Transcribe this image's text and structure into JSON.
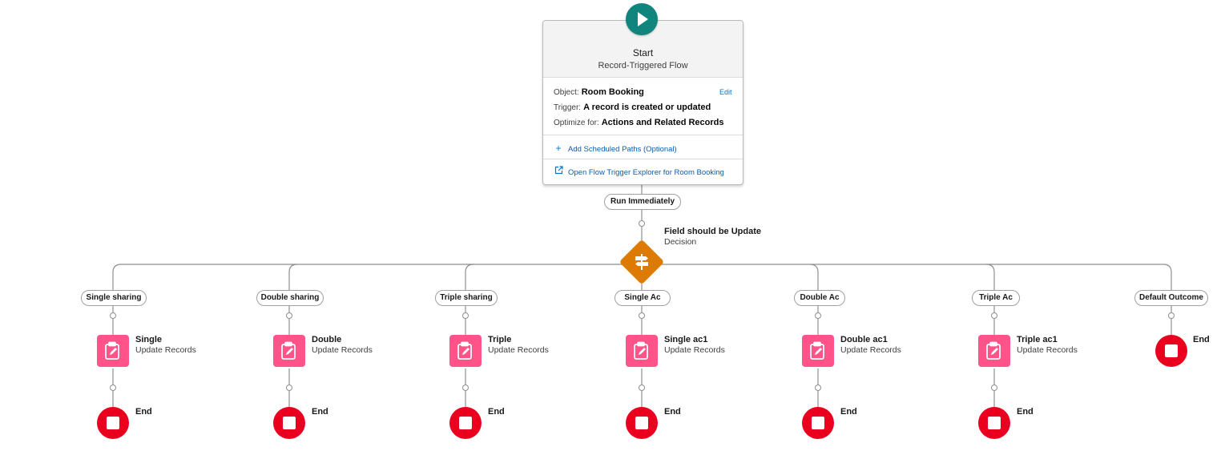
{
  "start": {
    "title": "Start",
    "subtitle": "Record-Triggered Flow",
    "object_label": "Object:",
    "object_value": "Room Booking",
    "edit_label": "Edit",
    "trigger_label": "Trigger:",
    "trigger_value": "A record is created or updated",
    "optimize_label": "Optimize for:",
    "optimize_value": "Actions and Related Records",
    "add_scheduled": "Add Scheduled Paths (Optional)",
    "open_explorer": "Open Flow Trigger Explorer for Room Booking"
  },
  "run_immediately": "Run Immediately",
  "decision": {
    "title": "Field should be Update",
    "type": "Decision"
  },
  "branches": [
    {
      "outcome": "Single sharing",
      "element": "Single",
      "element_type": "Update Records",
      "end": "End"
    },
    {
      "outcome": "Double sharing",
      "element": "Double",
      "element_type": "Update Records",
      "end": "End"
    },
    {
      "outcome": "Triple sharing",
      "element": "Triple",
      "element_type": "Update Records",
      "end": "End"
    },
    {
      "outcome": "Single Ac",
      "element": "Single ac1",
      "element_type": "Update Records",
      "end": "End"
    },
    {
      "outcome": "Double Ac",
      "element": "Double ac1",
      "element_type": "Update Records",
      "end": "End"
    },
    {
      "outcome": "Triple Ac",
      "element": "Triple ac1",
      "element_type": "Update Records",
      "end": "End"
    }
  ],
  "default_outcome": {
    "outcome": "Default Outcome",
    "end": "End"
  },
  "colors": {
    "start": "#10857d",
    "decision": "#dd7a01",
    "update_records": "#ff538a",
    "end": "#ea001e",
    "link": "#0176d3"
  }
}
